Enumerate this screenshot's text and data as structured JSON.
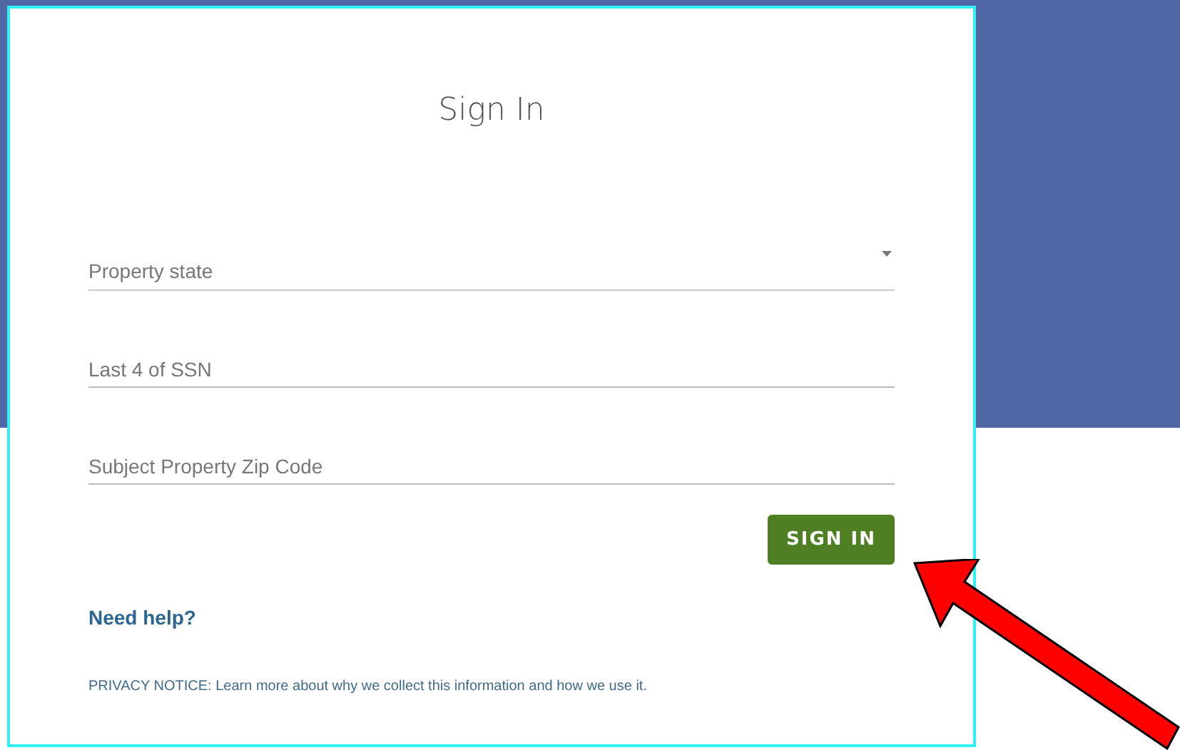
{
  "title": "Sign In",
  "fields": [
    {
      "kind": "select",
      "placeholder": "Property state"
    },
    {
      "kind": "text",
      "placeholder": "Last 4 of SSN"
    },
    {
      "kind": "text",
      "placeholder": "Subject Property Zip Code"
    }
  ],
  "submit": "SIGN IN",
  "help_link": "Need help?",
  "privacy_notice": "PRIVACY NOTICE: Learn more about why we collect this information and how we use it."
}
